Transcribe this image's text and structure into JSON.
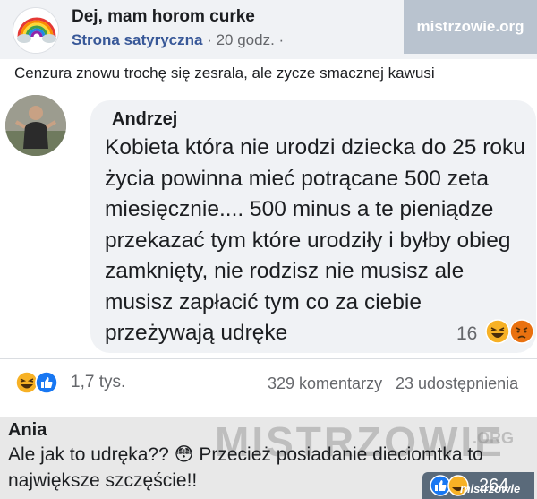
{
  "post": {
    "page_name": "Dej, mam horom curke",
    "page_sub": "Strona satyryczna",
    "time": "· 20 godz. ·",
    "text": "Cenzura znowu trochę się zesrala, ale zycze smacznej kawusi"
  },
  "watermark": {
    "top": "mistrzowie.org",
    "big": "MISTRZOWIE",
    "org": ".ORG",
    "brand": "mistrzowie"
  },
  "comment": {
    "author": "Andrzej",
    "text": "Kobieta która nie urodzi dziecka do 25 roku życia powinna mieć potrącane 500 zeta miesięcznie.... 500 minus a te pieniądze przekazać tym które urodziły i byłby obieg zamknięty, nie rodzisz nie musisz ale musisz zapłacić tym co za ciebie przeżywają udręke",
    "reactions_count": "16"
  },
  "stats": {
    "likes": "1,7 tys.",
    "comments": "329 komentarzy",
    "shares": "23 udostępnienia"
  },
  "reply": {
    "author": "Ania",
    "text": "Ale jak to udręka?? 😳 Przecież posiadanie dieciomtka to największe szczęście!!",
    "reactions_count": "264"
  },
  "colors": {
    "header_bg": "#f0f2f5",
    "link": "#385898",
    "meta": "#65676b",
    "watermark_box": "#b9c3cf",
    "reply_bg": "#e8e8e8"
  }
}
